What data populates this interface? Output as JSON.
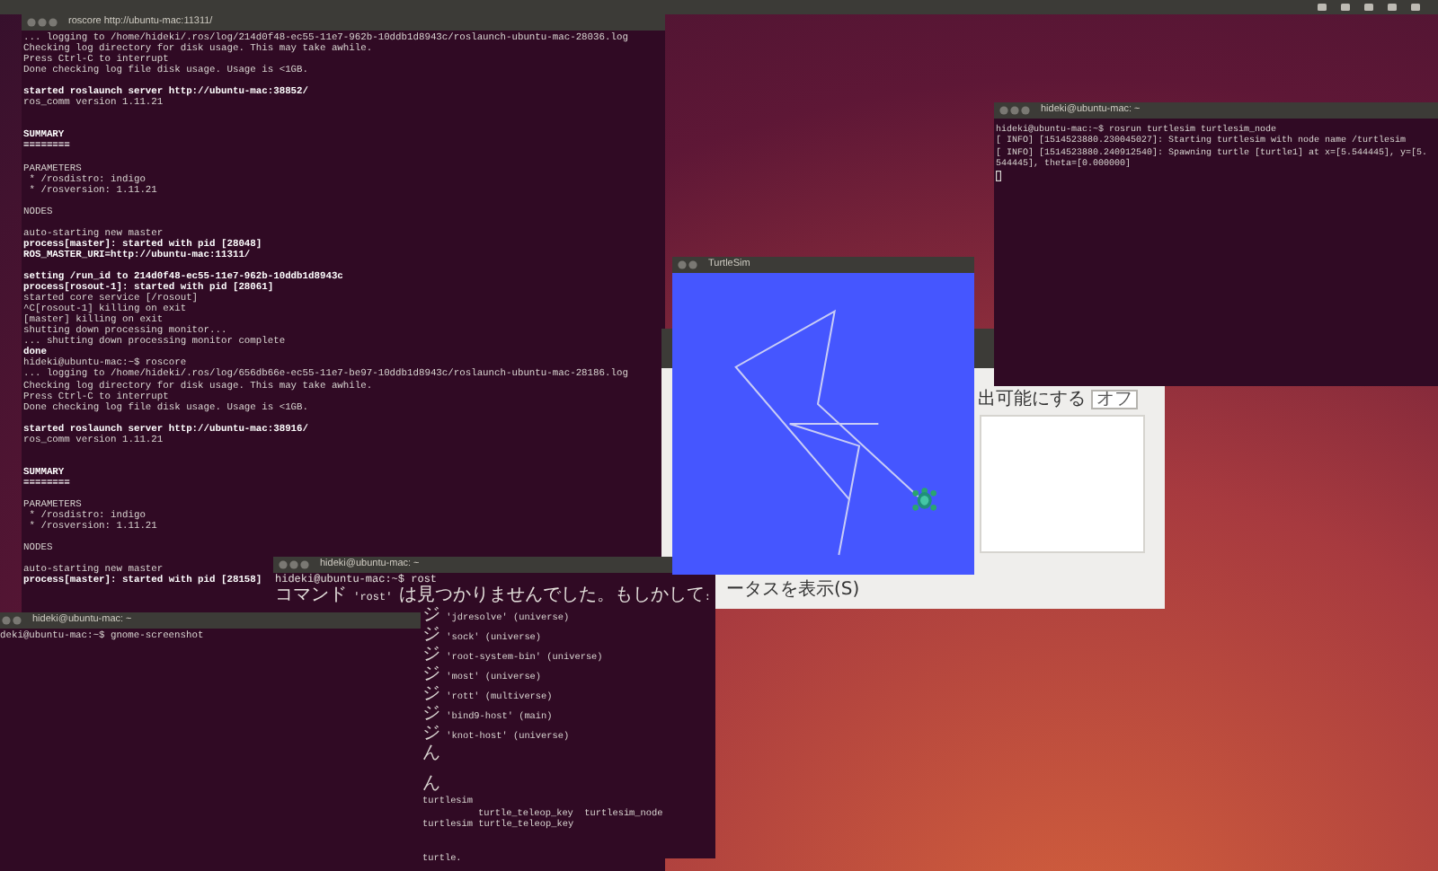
{
  "roscore_terminal": {
    "title": "roscore http://ubuntu-mac:11311/",
    "lines": [
      {
        "kind": "text",
        "text": "... logging to /home/hideki/.ros/log/214d0f48-ec55-11e7-962b-10ddb1d8943c/roslaunch-ubuntu-mac-28036.log",
        "bold": false
      },
      {
        "kind": "text",
        "text": "Checking log directory for disk usage. This may take awhile.",
        "bold": false
      },
      {
        "kind": "text",
        "text": "Press Ctrl-C to interrupt",
        "bold": false
      },
      {
        "kind": "text",
        "text": "Done checking log file disk usage. Usage is <1GB.",
        "bold": false
      },
      {
        "kind": "blank"
      },
      {
        "kind": "text",
        "text": "started roslaunch server http://ubuntu-mac:38852/",
        "bold": true
      },
      {
        "kind": "text",
        "text": "ros_comm version 1.11.21",
        "bold": false
      },
      {
        "kind": "blank"
      },
      {
        "kind": "blank"
      },
      {
        "kind": "text",
        "text": "SUMMARY",
        "bold": true
      },
      {
        "kind": "text",
        "text": "========",
        "bold": true
      },
      {
        "kind": "blank"
      },
      {
        "kind": "text",
        "text": "PARAMETERS",
        "bold": false
      },
      {
        "kind": "text",
        "text": " * /rosdistro: indigo",
        "bold": false
      },
      {
        "kind": "text",
        "text": " * /rosversion: 1.11.21",
        "bold": false
      },
      {
        "kind": "blank"
      },
      {
        "kind": "text",
        "text": "NODES",
        "bold": false
      },
      {
        "kind": "blank"
      },
      {
        "kind": "text",
        "text": "auto-starting new master",
        "bold": false
      },
      {
        "kind": "text",
        "text": "process[master]: started with pid [28048]",
        "bold": true
      },
      {
        "kind": "text",
        "text": "ROS_MASTER_URI=http://ubuntu-mac:11311/",
        "bold": true
      },
      {
        "kind": "blank"
      },
      {
        "kind": "text",
        "text": "setting /run_id to 214d0f48-ec55-11e7-962b-10ddb1d8943c",
        "bold": true
      },
      {
        "kind": "text",
        "text": "process[rosout-1]: started with pid [28061]",
        "bold": true
      },
      {
        "kind": "text",
        "text": "started core service [/rosout]",
        "bold": false
      },
      {
        "kind": "text",
        "text": "^C[rosout-1] killing on exit",
        "bold": false
      },
      {
        "kind": "text",
        "text": "[master] killing on exit",
        "bold": false
      },
      {
        "kind": "text",
        "text": "shutting down processing monitor...",
        "bold": false
      },
      {
        "kind": "text",
        "text": "... shutting down processing monitor complete",
        "bold": false
      },
      {
        "kind": "text",
        "text": "done",
        "bold": true
      },
      {
        "kind": "text",
        "text": "hideki@ubuntu-mac:~$ roscore",
        "bold": false
      },
      {
        "kind": "text",
        "text": "... logging to /home/hideki/.ros/log/656db66e-ec55-11e7-be97-10ddb1d8943c/roslaunch-ubuntu-mac-28186.log",
        "bold": false
      },
      {
        "kind": "text",
        "text": "Checking log directory for disk usage. This may take awhile.",
        "bold": false
      },
      {
        "kind": "text",
        "text": "Press Ctrl-C to interrupt",
        "bold": false
      },
      {
        "kind": "text",
        "text": "Done checking log file disk usage. Usage is <1GB.",
        "bold": false
      },
      {
        "kind": "blank"
      },
      {
        "kind": "text",
        "text": "started roslaunch server http://ubuntu-mac:38916/",
        "bold": true
      },
      {
        "kind": "text",
        "text": "ros_comm version 1.11.21",
        "bold": false
      },
      {
        "kind": "blank"
      },
      {
        "kind": "blank"
      },
      {
        "kind": "text",
        "text": "SUMMARY",
        "bold": true
      },
      {
        "kind": "text",
        "text": "========",
        "bold": true
      },
      {
        "kind": "blank"
      },
      {
        "kind": "text",
        "text": "PARAMETERS",
        "bold": false
      },
      {
        "kind": "text",
        "text": " * /rosdistro: indigo",
        "bold": false
      },
      {
        "kind": "text",
        "text": " * /rosversion: 1.11.21",
        "bold": false
      },
      {
        "kind": "blank"
      },
      {
        "kind": "text",
        "text": "NODES",
        "bold": false
      },
      {
        "kind": "blank"
      },
      {
        "kind": "text",
        "text": "auto-starting new master",
        "bold": false
      },
      {
        "kind": "text",
        "text": "process[master]: started with pid [28158]",
        "bold": true
      }
    ]
  },
  "settings_dialog": {
    "option_label": "出可能にする",
    "switch": {
      "label": "オフ",
      "on": false
    },
    "checkbox_label": "ータスを表示(S)"
  },
  "turtlesim": {
    "title": "TurtleSim"
  },
  "turtlesim_terminal": {
    "title": "hideki@ubuntu-mac: ~",
    "lines": [
      "hideki@ubuntu-mac:~$ rosrun turtlesim turtlesim_node",
      "[ INFO] [1514523880.230045027]: Starting turtlesim with node name /turtlesim",
      "[ INFO] [1514523880.240912540]: Spawning turtle [turtle1] at x=[5.544445], y=[5.",
      "544445], theta=[0.000000]"
    ]
  },
  "rost_terminal": {
    "title": "hideki@ubuntu-mac: ~",
    "lines": [
      "hideki@ubuntu-mac:~$ rost",
      "コマンド 'rost' は見つかりませんでした。もしかして:"
    ],
    "suggestions": [
      {
        "kind": "text",
        "text": "ジ 'jdresolve' (universe)"
      },
      {
        "kind": "text",
        "text": "ジ 'sock' (universe)"
      },
      {
        "kind": "text",
        "text": "ジ 'root-system-bin' (universe)"
      },
      {
        "kind": "text",
        "text": "ジ 'most' (universe)"
      },
      {
        "kind": "text",
        "text": "ジ 'rott' (multiverse)"
      },
      {
        "kind": "text",
        "text": "ジ 'bind9-host' (main)"
      },
      {
        "kind": "text",
        "text": "ジ 'knot-host' (universe)"
      },
      {
        "kind": "text",
        "text": "ん"
      },
      {
        "kind": "blank"
      },
      {
        "kind": "text",
        "text": "ん"
      },
      {
        "kind": "text",
        "text": "turtlesim"
      },
      {
        "kind": "indented",
        "text": "turtle_teleop_key  turtlesim_node"
      },
      {
        "kind": "text",
        "text": "turtlesim turtle_teleop_key"
      },
      {
        "kind": "blank"
      },
      {
        "kind": "blank"
      },
      {
        "kind": "text",
        "text": "turtle."
      }
    ]
  },
  "screenshot_terminal": {
    "title": "hideki@ubuntu-mac: ~",
    "lines": [
      "deki@ubuntu-mac:~$ gnome-screenshot"
    ]
  }
}
